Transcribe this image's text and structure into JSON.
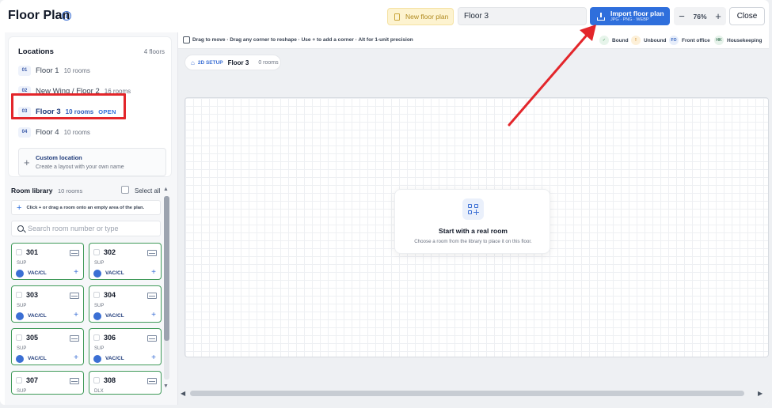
{
  "header": {
    "title": "Floor Plan",
    "new_floor_label": "New floor plan",
    "floor_name_value": "Floor 3",
    "import_label": "Import floor plan",
    "import_formats": "JPG · PNG · WEBP",
    "zoom_minus": "−",
    "zoom_value": "76%",
    "zoom_plus": "+",
    "close_label": "Close"
  },
  "locations": {
    "title": "Locations",
    "count": "4 floors",
    "items": [
      {
        "num": "01",
        "name": "Floor 1",
        "rooms": "10 rooms",
        "open": ""
      },
      {
        "num": "02",
        "name": "New Wing / Floor 2",
        "rooms": "16 rooms",
        "open": ""
      },
      {
        "num": "03",
        "name": "Floor 3",
        "rooms": "10 rooms",
        "open": "OPEN"
      },
      {
        "num": "04",
        "name": "Floor 4",
        "rooms": "10 rooms",
        "open": ""
      }
    ],
    "custom_title": "Custom location",
    "custom_sub": "Create a layout with your own name"
  },
  "library": {
    "title": "Room library",
    "count": "10 rooms",
    "select_all": "Select all",
    "hint": "Click + or drag a room onto an empty area of the plan.",
    "search_placeholder": "Search room number or type",
    "rooms": [
      {
        "num": "301",
        "type": "SUP",
        "status": "VAC/CL"
      },
      {
        "num": "302",
        "type": "SUP",
        "status": "VAC/CL"
      },
      {
        "num": "303",
        "type": "SUP",
        "status": "VAC/CL"
      },
      {
        "num": "304",
        "type": "SUP",
        "status": "VAC/CL"
      },
      {
        "num": "305",
        "type": "SUP",
        "status": "VAC/CL"
      },
      {
        "num": "306",
        "type": "SUP",
        "status": "VAC/CL"
      },
      {
        "num": "307",
        "type": "SUP",
        "status": ""
      },
      {
        "num": "308",
        "type": "DLX",
        "status": ""
      }
    ]
  },
  "toolbar": {
    "hint": "Drag to move · Drag any corner to reshape · Use + to add a corner · Alt for 1-unit precision",
    "legend": [
      {
        "code": "✓",
        "label": "Bound",
        "color": "#3f9a59",
        "bg": "#e6f4ea"
      },
      {
        "code": "!",
        "label": "Unbound",
        "color": "#c77d12",
        "bg": "#fdf0d8"
      },
      {
        "code": "FO",
        "label": "Front office",
        "color": "#2f5fbd",
        "bg": "#e6edfa"
      },
      {
        "code": "HK",
        "label": "Housekeeping",
        "color": "#3f7a5a",
        "bg": "#e6f2ea"
      }
    ]
  },
  "canvas": {
    "setup_tag": "2D SETUP",
    "floor": "Floor 3",
    "rooms": "0 rooms",
    "empty_title": "Start with a real room",
    "empty_sub": "Choose a room from the library to place it on this floor."
  },
  "colors": {
    "accent": "#2f6fdc",
    "highlight": "#e3262b",
    "room_border": "#3f9a59"
  }
}
